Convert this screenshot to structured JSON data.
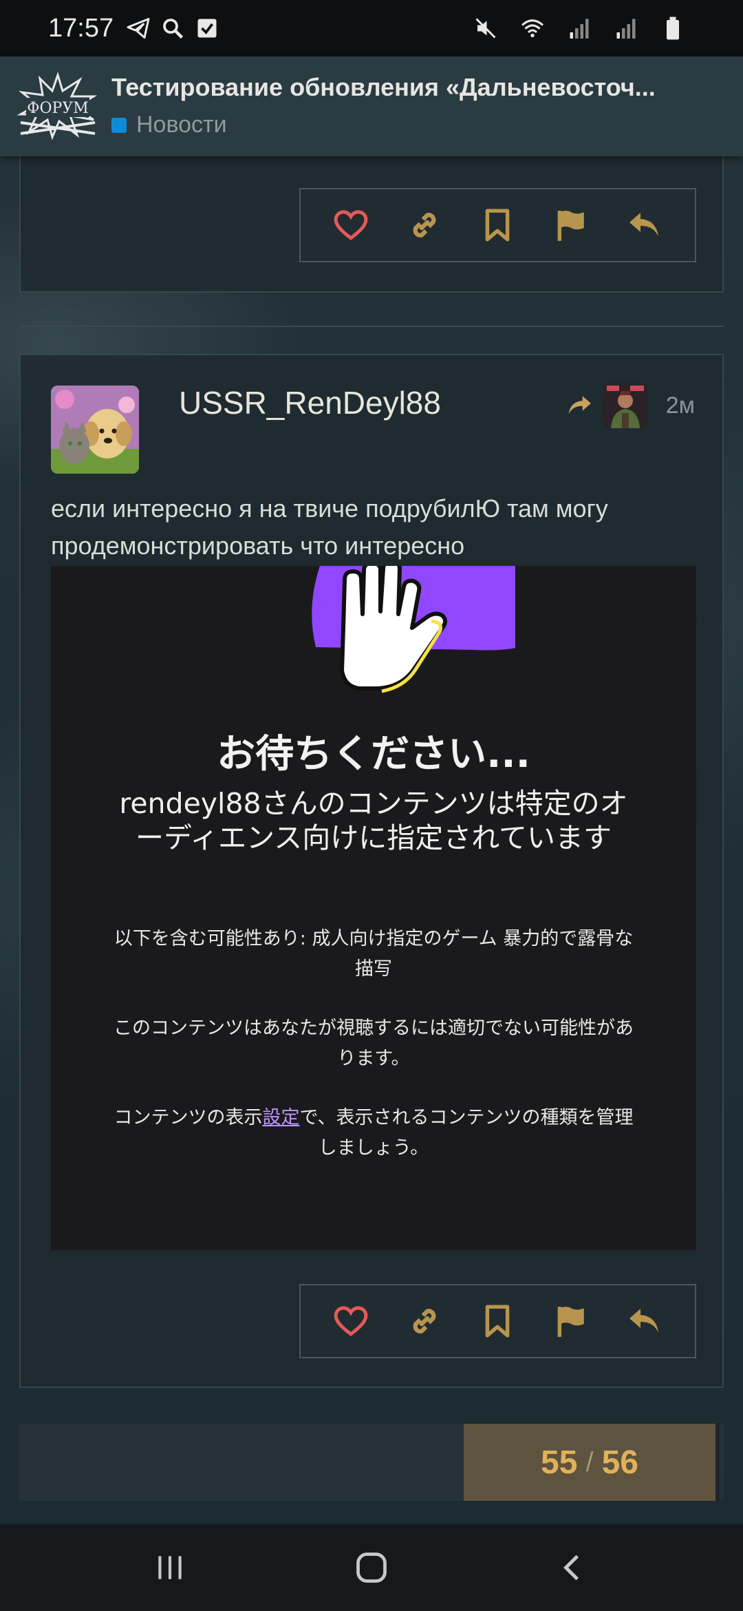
{
  "status_bar": {
    "time": "17:57",
    "icons_left": [
      "telegram-icon",
      "search-icon",
      "checkbox-icon"
    ],
    "icons_right": [
      "mute-icon",
      "wifi-icon",
      "signal-icon",
      "signal-icon",
      "battery-icon"
    ]
  },
  "header": {
    "logo_text": "ФОРУМ",
    "title": "Тестирование обновления «Дальневосточ...",
    "category": "Новости",
    "category_color": "#0d8bd9"
  },
  "post": {
    "username": "USSR_RenDeyl88",
    "time": "2м",
    "text": "если интересно я на твиче подрубилЮ там могу продемонстрировать что интересно",
    "embed": {
      "title": "お待ちください...",
      "subtitle": "rendeyl88さんのコンテンツは特定のオーディエンス向けに指定されています",
      "p1": "以下を含む可能性あり: 成人向け指定のゲーム 暴力的で露骨な描写",
      "p2": "このコンテンツはあなたが視聴するには適切でない可能性があります。",
      "p3_before": "コンテンツの表示",
      "p3_link": "設定",
      "p3_after": "で、表示されるコンテンツの種類を管理しましょう。",
      "accent_color": "#9147ff"
    }
  },
  "actions": [
    "like-icon",
    "link-icon",
    "bookmark-icon",
    "flag-icon",
    "reply-icon"
  ],
  "pager": {
    "current": "55",
    "separator": "/",
    "total": "56"
  },
  "colors": {
    "accent_gold": "#c9a15f",
    "like_red": "#e45a57"
  }
}
